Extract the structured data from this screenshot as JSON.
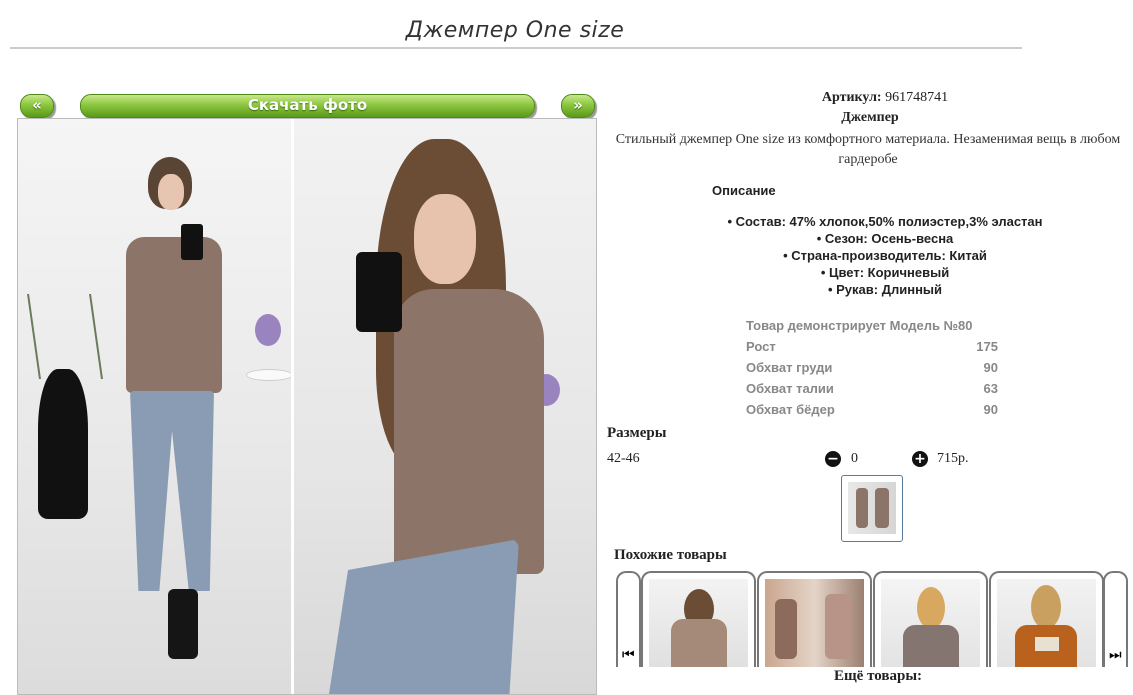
{
  "product": {
    "title": "Джемпер One size",
    "sku_label": "Артикул:",
    "sku_value": "961748741",
    "name": "Джемпер",
    "description": "Стильный джемпер One size из комфортного материала. Незаменимая вещь в любом гардеробе"
  },
  "gallery": {
    "prev_label": "«",
    "download_label": "Скачать фото",
    "next_label": "»"
  },
  "details": {
    "heading": "Описание",
    "properties": [
      "• Состав: 47% хлопок,50% полиэстер,3% эластан",
      "• Сезон: Осень-весна",
      "• Страна-производитель: Китай",
      "• Цвет: Коричневый",
      "• Рукав: Длинный"
    ]
  },
  "model": {
    "heading": "Товар демонстрирует Модель №80",
    "rows": [
      {
        "label": "Рост",
        "value": "175"
      },
      {
        "label": "Обхват груди",
        "value": "90"
      },
      {
        "label": "Обхват талии",
        "value": "63"
      },
      {
        "label": "Обхват бёдер",
        "value": "90"
      }
    ]
  },
  "sizes": {
    "heading": "Размеры",
    "size": "42-46",
    "quantity": "0",
    "price": "715р.",
    "minus_icon": "minus-circle-icon",
    "plus_icon": "plus-circle-icon"
  },
  "similar": {
    "heading": "Похожие товары",
    "prev_icon": "skip-back-icon",
    "next_icon": "skip-forward-icon",
    "glyph_prev": "⏮",
    "glyph_next": "⏭"
  },
  "more": {
    "heading": "Ещё товары:"
  },
  "colors": {
    "button_green": "#8cc63f",
    "sweater_brown": "#8c7468",
    "jeans_blue": "#8a9cb4"
  }
}
